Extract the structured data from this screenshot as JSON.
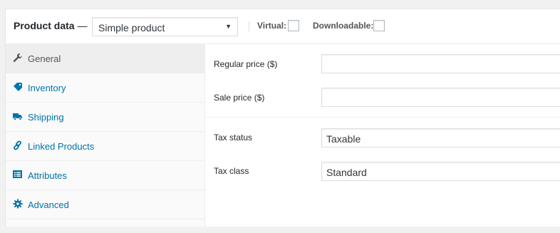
{
  "header": {
    "title": "Product data",
    "title_dash": "—",
    "product_type": "Simple product",
    "virtual_label": "Virtual:",
    "downloadable_label": "Downloadable:"
  },
  "tabs": [
    {
      "label": "General",
      "icon": "wrench-icon",
      "active": true
    },
    {
      "label": "Inventory",
      "icon": "tag-icon",
      "active": false
    },
    {
      "label": "Shipping",
      "icon": "truck-icon",
      "active": false
    },
    {
      "label": "Linked Products",
      "icon": "link-icon",
      "active": false
    },
    {
      "label": "Attributes",
      "icon": "list-icon",
      "active": false
    },
    {
      "label": "Advanced",
      "icon": "gear-icon",
      "active": false
    }
  ],
  "general": {
    "regular_price_label": "Regular price ($)",
    "regular_price_value": "",
    "sale_price_label": "Sale price ($)",
    "sale_price_value": "",
    "tax_status_label": "Tax status",
    "tax_status_value": "Taxable",
    "tax_class_label": "Tax class",
    "tax_class_value": "Standard"
  },
  "colors": {
    "link": "#0073aa",
    "active_tab_bg": "#eeeeee",
    "sidebar_bg": "#fafafa"
  }
}
